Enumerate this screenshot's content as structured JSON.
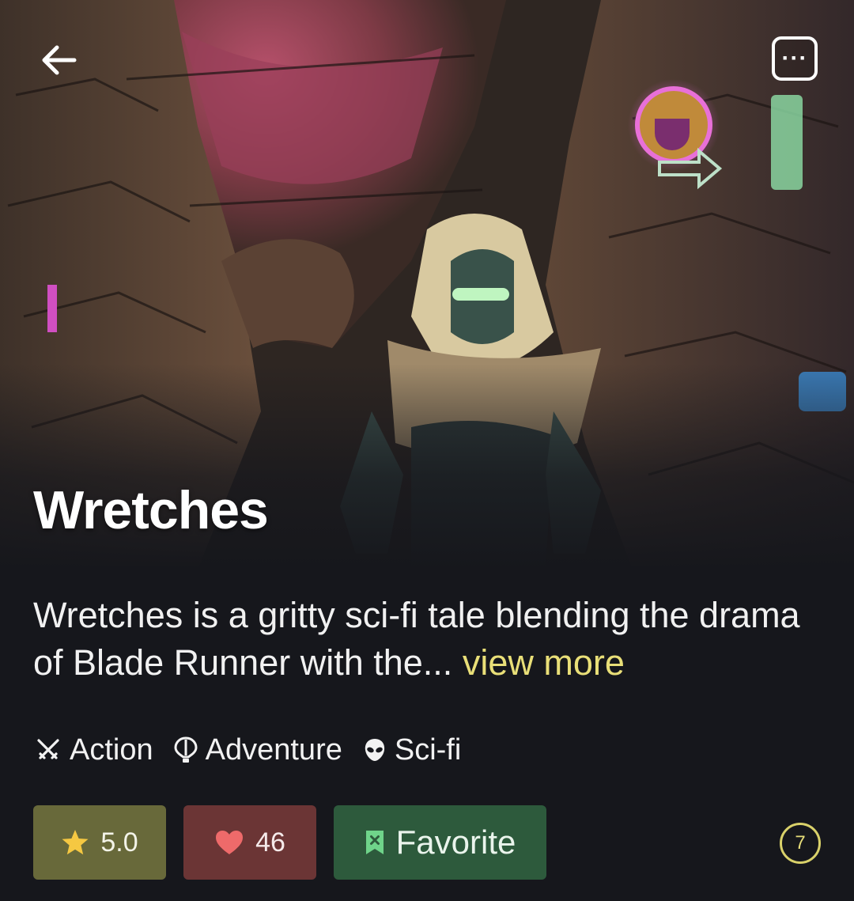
{
  "header": {
    "back_icon": "arrow-left-icon",
    "menu_icon": "more-dots-icon",
    "menu_label": "···"
  },
  "comic": {
    "title": "Wretches",
    "description": "Wretches is a gritty sci-fi tale blending the drama of Blade Runner with the...",
    "view_more_label": "view more"
  },
  "genres": [
    {
      "icon": "crossed-swords-icon",
      "label": "Action"
    },
    {
      "icon": "hot-air-balloon-icon",
      "label": "Adventure"
    },
    {
      "icon": "alien-icon",
      "label": "Sci-fi"
    }
  ],
  "actions": {
    "rating": {
      "icon": "star-icon",
      "value": "5.0"
    },
    "likes": {
      "icon": "heart-icon",
      "value": "46"
    },
    "favorite": {
      "icon": "bookmark-icon",
      "label": "Favorite"
    }
  },
  "badge": {
    "value": "7"
  },
  "colors": {
    "background": "#16171c",
    "accent_yellow": "#e9df78",
    "rating_bg": "#68693a",
    "likes_bg": "#6b3535",
    "favorite_bg": "#2d5a3c"
  }
}
